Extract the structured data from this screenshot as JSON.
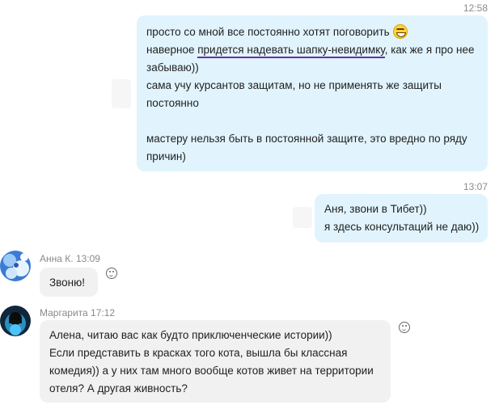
{
  "messages": {
    "out1": {
      "time": "12:58",
      "line1": "просто со мной все постоянно хотят поговорить",
      "line2_pre": "наверное ",
      "line2_underlined": "придется надевать шапку-невидимку",
      "line2_post": ", как же я про нее",
      "line3": "забываю))",
      "line4": "сама учу курсантов защитам, но не применять же защиты",
      "line5": "постоянно",
      "line6": "мастеру нельзя быть в постоянной защите, это вредно по ряду",
      "line7": "причин)",
      "emoji": "grinning-face-emoji"
    },
    "out2": {
      "time": "13:07",
      "line1": "Аня, звони в Тибет))",
      "line2": "я здесь консультаций не даю))"
    },
    "in1": {
      "sender": "Анна К.",
      "time": "13:09",
      "text": "Звоню!"
    },
    "in2": {
      "sender": "Маргарита",
      "time": "17:12",
      "line1": "Алена, читаю вас как будто приключенческие истории))",
      "line2": "Если представить в красках того кота, вышла бы классная",
      "line3": "комедия)) а у них там много вообще котов живет на территории",
      "line4": "отеля? А другая живность?"
    }
  },
  "icons": {
    "reaction": "smiley-reaction-icon",
    "emoji": "grinning-face-emoji"
  },
  "colors": {
    "outgoing_bubble": "#e1f4fd",
    "incoming_bubble": "#f1f1f1",
    "underline": "#6a2ea8"
  }
}
